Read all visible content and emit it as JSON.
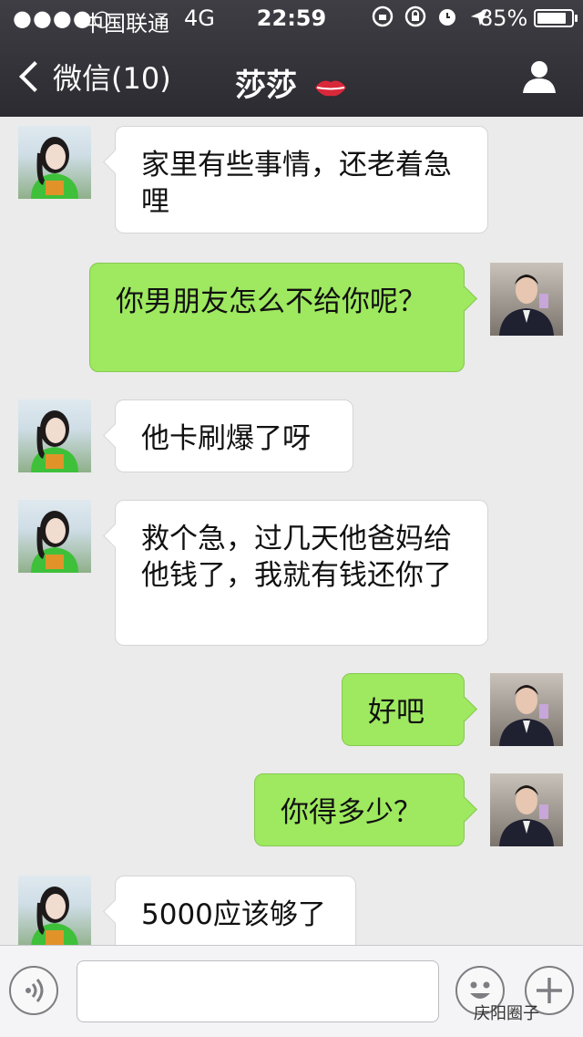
{
  "status_bar": {
    "signal": "●●●●○",
    "carrier": "中国联通",
    "network": "4G",
    "time": "22:59",
    "battery_percent": "85%",
    "battery_level": 0.85
  },
  "nav": {
    "back_label": "微信(10)",
    "title": "莎莎",
    "title_emoji": "lips-icon"
  },
  "messages": [
    {
      "side": "left",
      "text_lines": [
        "家里有些事情，还老着急",
        "哩"
      ]
    },
    {
      "side": "right",
      "text_lines": [
        "你男朋友怎么不给你呢？"
      ]
    },
    {
      "side": "left",
      "text_lines": [
        "他卡刷爆了呀"
      ]
    },
    {
      "side": "left",
      "text_lines": [
        "救个急，过几天他爸妈给",
        "他钱了，我就有钱还你了"
      ]
    },
    {
      "side": "right",
      "text_lines": [
        "好吧"
      ]
    },
    {
      "side": "right",
      "text_lines": [
        "你得多少？"
      ]
    },
    {
      "side": "left",
      "text_lines": [
        "5000应该够了"
      ]
    }
  ],
  "input_bar": {
    "voice_icon": "voice-icon",
    "emoji_icon": "smiley-icon",
    "plus_icon": "plus-icon",
    "watermark": "庆阳圈子"
  },
  "colors": {
    "nav_bg": "#2b2b31",
    "chat_bg": "#ebebeb",
    "bubble_sent": "#9ee95f",
    "bubble_received": "#ffffff"
  }
}
